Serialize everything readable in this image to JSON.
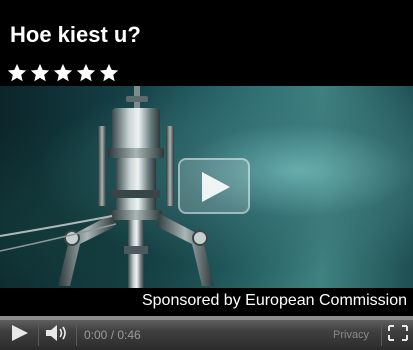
{
  "player": {
    "title": "Hoe kiest u?",
    "rating": {
      "value": 5,
      "max": 5
    },
    "sponsor_text": "Sponsored by European Commission",
    "controls": {
      "current_time": "0:00",
      "duration": "0:46",
      "time_separator": " / ",
      "privacy_label": "Privacy"
    },
    "icons": {
      "star": "star-icon",
      "big_play": "play-icon",
      "play": "play-icon",
      "volume": "speaker-icon",
      "fullscreen": "fullscreen-icon"
    },
    "colors": {
      "background": "#000000",
      "text": "#ffffff",
      "control_bar": "#3f3f3f",
      "time_text": "#9b9b9b"
    }
  }
}
